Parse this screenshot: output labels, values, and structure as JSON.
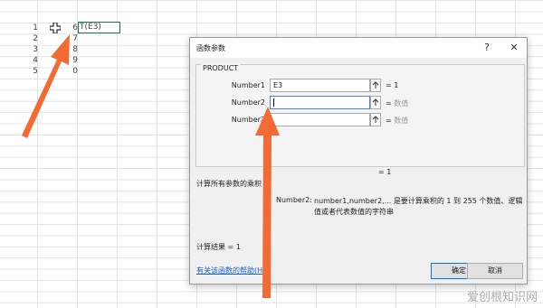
{
  "sheet": {
    "rows": [
      {
        "num": "1",
        "value": "6"
      },
      {
        "num": "2",
        "value": "7"
      },
      {
        "num": "3",
        "value": "8"
      },
      {
        "num": "4",
        "value": "9"
      },
      {
        "num": "5",
        "value": "0"
      }
    ],
    "formula_text": "T(E3)"
  },
  "dialog": {
    "title": "函数参数",
    "help_btn": "?",
    "close_btn": "✕",
    "function_name": "PRODUCT",
    "args": [
      {
        "label": "Number1",
        "value": "E3",
        "result": "= 1",
        "result_grey": ""
      },
      {
        "label": "Number2",
        "value": "",
        "result": "= ",
        "result_grey": "数值"
      },
      {
        "label": "Number3",
        "value": "",
        "result": "= ",
        "result_grey": "数值"
      }
    ],
    "total_result": "= 1",
    "description": "计算所有参数的乘积",
    "hint_label": "Number2:",
    "hint_text": "number1,number2,... 是要计算乘积的 1 到 255 个数值、逻辑值或者代表数值的字符串",
    "calc_result": "计算结果 =   1",
    "help_link": "有关该函数的帮助(H)",
    "ok": "确定",
    "cancel": "取消"
  },
  "watermark": "爱创根知识网",
  "colors": {
    "arrow": "#f36a32",
    "link": "#1a5ec7",
    "cell_border": "#217346"
  }
}
